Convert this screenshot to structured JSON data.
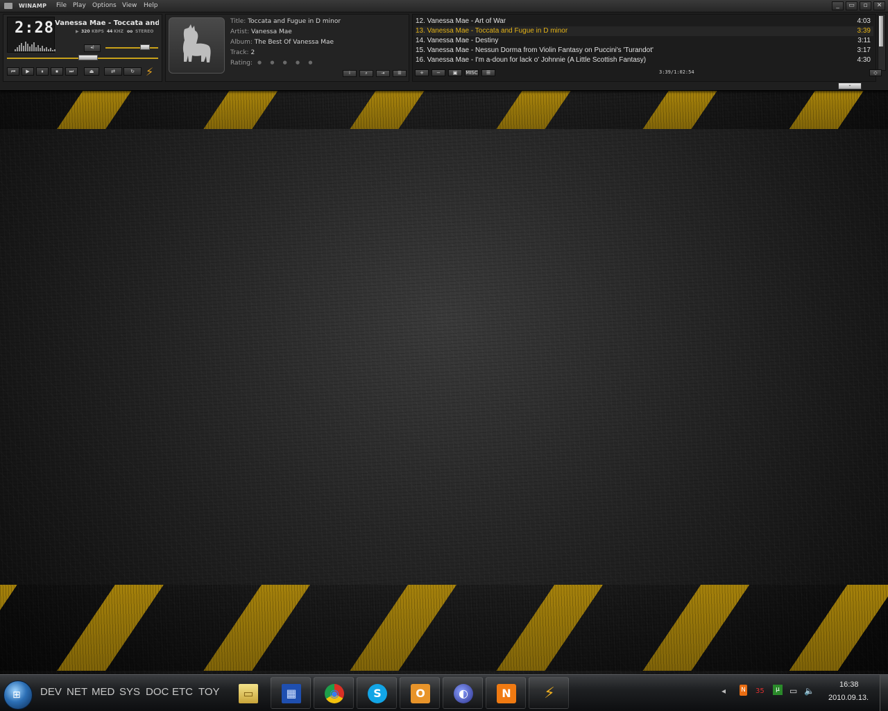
{
  "winamp": {
    "title": "WINAMP",
    "menu": [
      "File",
      "Play",
      "Options",
      "View",
      "Help"
    ],
    "window_buttons": [
      "_",
      "▭",
      "▫",
      "✕"
    ],
    "player": {
      "time": "2:28",
      "song": "Vanessa Mae - Toccata and Fugue in D minor",
      "kbps_value": "320",
      "kbps_label": "KBPS",
      "khz_value": "44",
      "khz_label": "KHZ",
      "channel_mode": "STEREO",
      "volume_level": 0.8,
      "seek_position": 0.54,
      "buttons": [
        "⏮",
        "▶",
        "⏸",
        "⏹",
        "⏭"
      ]
    },
    "info": {
      "title_key": "Title:",
      "title_val": "Toccata and Fugue in D minor",
      "artist_key": "Artist:",
      "artist_val": "Vanessa Mae",
      "album_key": "Album:",
      "album_val": "The Best Of Vanessa Mae",
      "track_key": "Track:",
      "track_val": "2",
      "rating_key": "Rating:",
      "rating_stars": "● ● ● ● ●"
    },
    "playlist": {
      "items": [
        {
          "title": "12. Vanessa Mae - Art of War",
          "duration": "4:03",
          "current": false
        },
        {
          "title": "13. Vanessa Mae - Toccata and Fugue in D minor",
          "duration": "3:39",
          "current": true
        },
        {
          "title": "14. Vanessa Mae - Destiny",
          "duration": "3:11",
          "current": false
        },
        {
          "title": "15. Vanessa Mae - Nessun Dorma from Violin Fantasy on Puccini's 'Turandot'",
          "duration": "3:17",
          "current": false
        },
        {
          "title": "16. Vanessa Mae - I'm a-doun for lack o' Johnnie (A Little Scottish Fantasy)",
          "duration": "4:30",
          "current": false
        }
      ],
      "total_time": "3:39/1:02:54",
      "misc_label": "MISC",
      "accent_color": "#e4b317"
    }
  },
  "taskbar": {
    "quick_launch": [
      "DEV",
      "NET",
      "MED",
      "SYS",
      "DOC",
      "ETC",
      "TOY"
    ],
    "apps": [
      {
        "name": "windows-explorer",
        "glyph": "▭"
      },
      {
        "name": "calculator-app",
        "glyph": "▦"
      },
      {
        "name": "chrome",
        "glyph": "◉"
      },
      {
        "name": "skype",
        "glyph": "S"
      },
      {
        "name": "outlook",
        "glyph": "O"
      },
      {
        "name": "eclipse",
        "glyph": "◐"
      },
      {
        "name": "nateon",
        "glyph": "N"
      },
      {
        "name": "winamp",
        "glyph": "⚡"
      }
    ],
    "tray": {
      "badge_count": "35",
      "time": "16:38",
      "date": "2010.09.13."
    }
  }
}
